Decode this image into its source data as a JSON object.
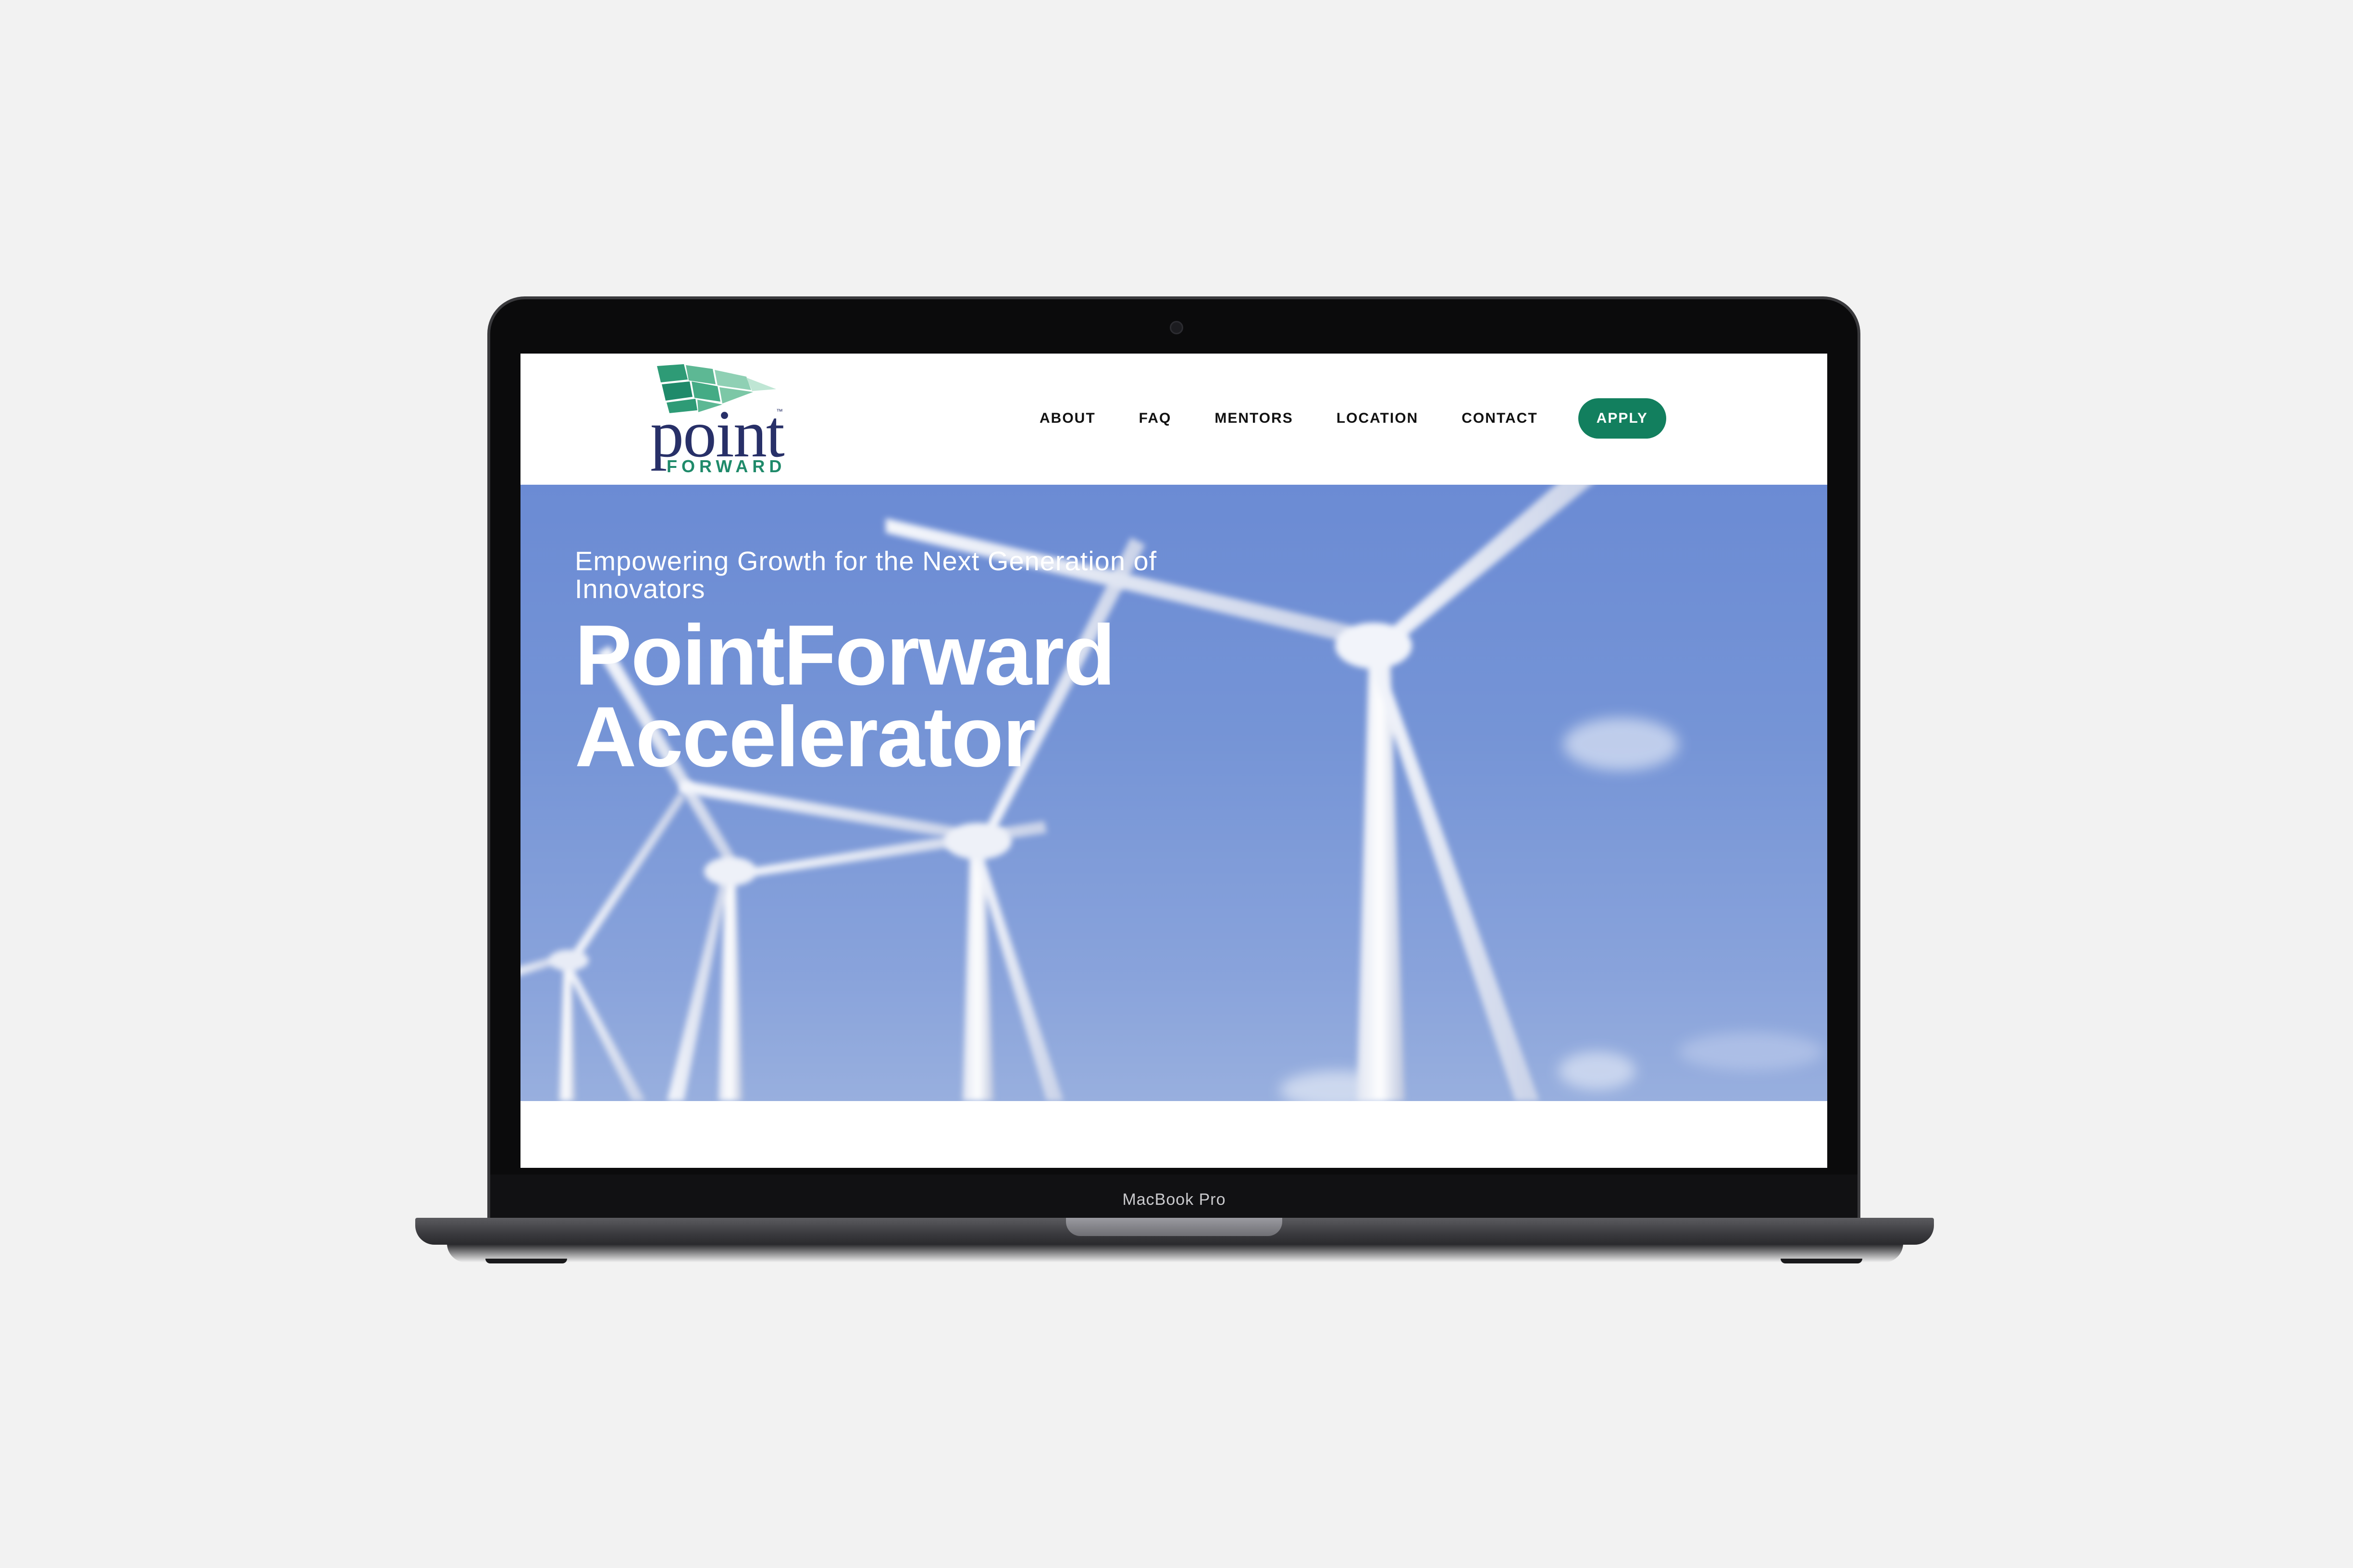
{
  "device": {
    "model_label": "MacBook Pro"
  },
  "site": {
    "logo": {
      "word": "point",
      "trademark": "™",
      "sub": "FORWARD",
      "icon": "flag-icon"
    },
    "nav": {
      "items": [
        "ABOUT",
        "FAQ",
        "MENTORS",
        "LOCATION",
        "CONTACT"
      ],
      "cta": "APPLY"
    },
    "hero": {
      "subtitle": "Empowering Growth for the Next Generation of Innovators",
      "title_line1": "PointForward",
      "title_line2": "Accelerator",
      "image": "wind-turbines-photo"
    }
  },
  "colors": {
    "brand_navy": "#283068",
    "brand_green": "#127f5e",
    "logo_green": "#1f8a6a",
    "sky": "#7594d6",
    "page_bg": "#f2f2f2"
  }
}
